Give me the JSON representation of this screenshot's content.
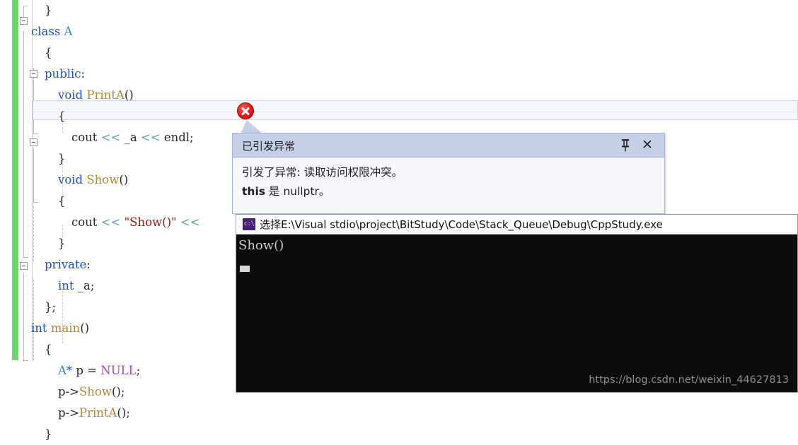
{
  "editor": {
    "change_bar_color": "#67d96c",
    "current_line_index": 5,
    "lines": [
      {
        "indent": 1,
        "tokens": [
          {
            "c": "pl",
            "t": "}"
          }
        ]
      },
      {
        "indent": 0,
        "fold": true,
        "tokens": [
          {
            "c": "kw",
            "t": "class"
          },
          {
            "c": "pl",
            "t": " "
          },
          {
            "c": "ty",
            "t": "A"
          }
        ]
      },
      {
        "indent": 1,
        "tokens": [
          {
            "c": "pl",
            "t": "{"
          }
        ]
      },
      {
        "indent": 1,
        "tokens": [
          {
            "c": "kw",
            "t": "public"
          },
          {
            "c": "pl",
            "t": ":"
          }
        ]
      },
      {
        "indent": 2,
        "fold": true,
        "tokens": [
          {
            "c": "kw",
            "t": "void"
          },
          {
            "c": "pl",
            "t": " "
          },
          {
            "c": "fn",
            "t": "PrintA"
          },
          {
            "c": "pl",
            "t": "()"
          }
        ]
      },
      {
        "indent": 2,
        "tokens": [
          {
            "c": "pl",
            "t": "{"
          }
        ]
      },
      {
        "indent": 3,
        "tokens": [
          {
            "c": "pl",
            "t": "cout "
          },
          {
            "c": "op",
            "t": "<<"
          },
          {
            "c": "pl",
            "t": " _a "
          },
          {
            "c": "op",
            "t": "<<"
          },
          {
            "c": "pl",
            "t": " endl;"
          }
        ]
      },
      {
        "indent": 2,
        "tokens": [
          {
            "c": "pl",
            "t": "}"
          }
        ]
      },
      {
        "indent": 2,
        "fold": true,
        "tokens": [
          {
            "c": "kw",
            "t": "void"
          },
          {
            "c": "pl",
            "t": " "
          },
          {
            "c": "fn",
            "t": "Show"
          },
          {
            "c": "pl",
            "t": "()"
          }
        ]
      },
      {
        "indent": 2,
        "tokens": [
          {
            "c": "pl",
            "t": "{"
          }
        ]
      },
      {
        "indent": 3,
        "tokens": [
          {
            "c": "pl",
            "t": "cout "
          },
          {
            "c": "op",
            "t": "<<"
          },
          {
            "c": "pl",
            "t": " "
          },
          {
            "c": "str",
            "t": "\"Show()\""
          },
          {
            "c": "pl",
            "t": " "
          },
          {
            "c": "op",
            "t": "<<"
          }
        ]
      },
      {
        "indent": 2,
        "tokens": [
          {
            "c": "pl",
            "t": "}"
          }
        ]
      },
      {
        "indent": 1,
        "tokens": [
          {
            "c": "kw",
            "t": "private"
          },
          {
            "c": "pl",
            "t": ":"
          }
        ]
      },
      {
        "indent": 2,
        "tokens": [
          {
            "c": "kw",
            "t": "int"
          },
          {
            "c": "pl",
            "t": " _a;"
          }
        ]
      },
      {
        "indent": 1,
        "tokens": [
          {
            "c": "pl",
            "t": "};"
          }
        ]
      },
      {
        "indent": 0,
        "fold": true,
        "tokens": [
          {
            "c": "kw",
            "t": "int"
          },
          {
            "c": "pl",
            "t": " "
          },
          {
            "c": "fn",
            "t": "main"
          },
          {
            "c": "pl",
            "t": "()"
          }
        ]
      },
      {
        "indent": 1,
        "tokens": [
          {
            "c": "pl",
            "t": "{"
          }
        ]
      },
      {
        "indent": 2,
        "tokens": [
          {
            "c": "ty",
            "t": "A"
          },
          {
            "c": "kw",
            "t": "*"
          },
          {
            "c": "pl",
            "t": " p = "
          },
          {
            "c": "mac",
            "t": "NULL"
          },
          {
            "c": "pl",
            "t": ";"
          }
        ]
      },
      {
        "indent": 2,
        "tokens": [
          {
            "c": "pl",
            "t": "p->"
          },
          {
            "c": "fn",
            "t": "Show"
          },
          {
            "c": "pl",
            "t": "();"
          }
        ]
      },
      {
        "indent": 2,
        "tokens": [
          {
            "c": "pl",
            "t": "p->"
          },
          {
            "c": "fn",
            "t": "PrintA"
          },
          {
            "c": "pl",
            "t": "();"
          }
        ]
      },
      {
        "indent": 1,
        "tokens": [
          {
            "c": "pl",
            "t": "}"
          }
        ]
      }
    ]
  },
  "exception_popup": {
    "title": "已引发异常",
    "message_line1": "引发了异常: 读取访问权限冲突。",
    "message_bold": "this",
    "message_line2_rest": " 是 nullptr。",
    "pin_icon": "pin-icon",
    "close_icon": "close-icon",
    "close_label": "✕",
    "title_bar_color": "#c5cfe8",
    "border_color": "#a8b4d4"
  },
  "error_marker": {
    "icon": "error-circle-x-icon",
    "color": "#d81010"
  },
  "console_window": {
    "icon": "console-app-icon",
    "icon_label": "c:\\",
    "title": "选择E:\\Visual stdio\\project\\BitStudy\\Code\\Stack_Queue\\Debug\\CppStudy.exe",
    "output": "Show()",
    "background": "#0c0c0c"
  },
  "watermark": {
    "text": "https://blog.csdn.net/weixin_44627813"
  }
}
